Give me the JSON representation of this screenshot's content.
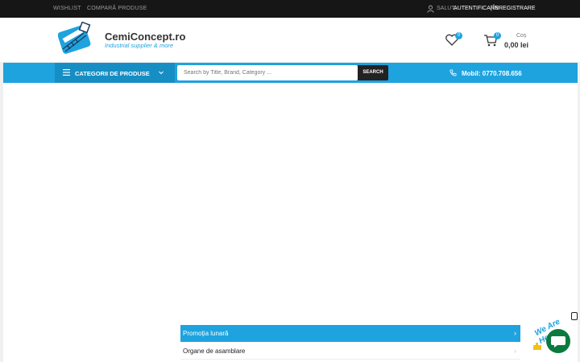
{
  "topbar": {
    "wishlist": "WISHLIST",
    "compare": "COMPARĂ PRODUSE",
    "greeting": "SALUT,",
    "login": "AUTENTIFICARE",
    "separator": "|",
    "register": "ÎNREGISTRARE"
  },
  "header": {
    "brand": "CemiConcept.ro",
    "tagline": "Industrial supplier & more",
    "wishlist_count": "0",
    "cart_count": "0",
    "cart_label": "Coș",
    "cart_total": "0,00 lei"
  },
  "nav": {
    "categories_label": "CATEGORII DE PRODUSE",
    "search_placeholder": "Search by Title, Brand, Category ...",
    "search_button": "SEARCH",
    "phone": "Mobil: 0770.708.656"
  },
  "menu": {
    "items": [
      {
        "label": "Promoția lunară",
        "active": true
      },
      {
        "label": "Organe de asamblare",
        "active": false
      }
    ]
  },
  "chat": {
    "label": "We Are Here!"
  },
  "colors": {
    "accent": "#1ea3df",
    "topbar": "#161616",
    "chat": "#0b7a3e"
  }
}
